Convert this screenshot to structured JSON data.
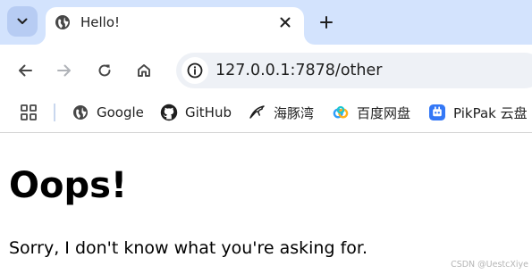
{
  "tab": {
    "title": "Hello!"
  },
  "omnibox": {
    "url": "127.0.0.1:7878/other"
  },
  "bookmarks": [
    {
      "label": "Google",
      "icon": "globe-icon"
    },
    {
      "label": "GitHub",
      "icon": "github-icon"
    },
    {
      "label": "海豚湾",
      "icon": "dolphin-icon"
    },
    {
      "label": "百度网盘",
      "icon": "baidu-netdisk-icon"
    },
    {
      "label": "PikPak 云盘",
      "icon": "pikpak-icon"
    }
  ],
  "page": {
    "heading": "Oops!",
    "message": "Sorry, I don't know what you're asking for."
  },
  "watermark": "CSDN @UestcXiye",
  "colors": {
    "tabstrip": "#d3e3fd",
    "omnibox": "#eef1f6",
    "icon": "#474747"
  }
}
